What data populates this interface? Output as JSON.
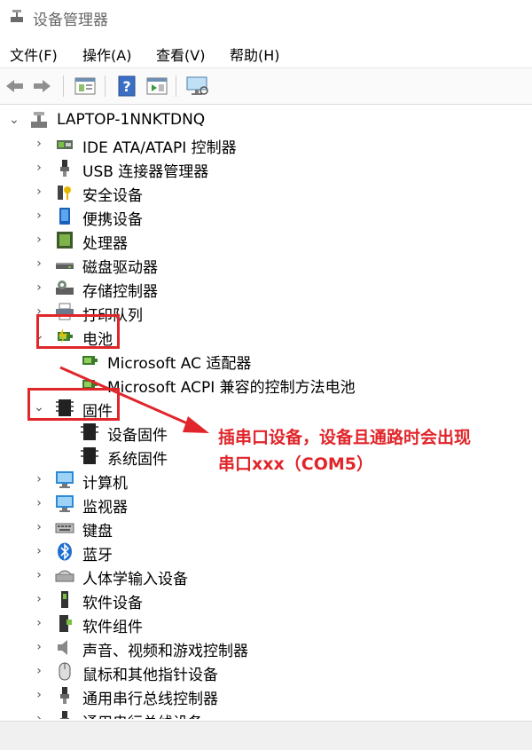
{
  "window": {
    "title": "设备管理器"
  },
  "menu": [
    "文件(F)",
    "操作(A)",
    "查看(V)",
    "帮助(H)"
  ],
  "toolbar": [
    "back-icon",
    "forward-icon",
    "properties-icon",
    "help-icon",
    "view-icon",
    "monitor-icon"
  ],
  "tree": {
    "root": "LAPTOP-1NNKTDNQ",
    "items": [
      {
        "label": "IDE ATA/ATAPI 控制器",
        "icon": "ide-controller-icon"
      },
      {
        "label": "USB 连接器管理器",
        "icon": "usb-icon"
      },
      {
        "label": "安全设备",
        "icon": "security-key-icon"
      },
      {
        "label": "便携设备",
        "icon": "portable-device-icon"
      },
      {
        "label": "处理器",
        "icon": "processor-icon"
      },
      {
        "label": "磁盘驱动器",
        "icon": "disk-drive-icon"
      },
      {
        "label": "存储控制器",
        "icon": "storage-controller-icon"
      },
      {
        "label": "打印队列",
        "icon": "printer-icon"
      },
      {
        "label": "电池",
        "icon": "battery-icon"
      },
      {
        "label": "Microsoft AC 适配器",
        "icon": "battery-icon"
      },
      {
        "label": "Microsoft ACPI 兼容的控制方法电池",
        "icon": "battery-icon"
      },
      {
        "label": "固件",
        "icon": "firmware-chip-icon"
      },
      {
        "label": "设备固件",
        "icon": "firmware-chip-icon"
      },
      {
        "label": "系统固件",
        "icon": "firmware-chip-icon"
      },
      {
        "label": "计算机",
        "icon": "computer-icon"
      },
      {
        "label": "监视器",
        "icon": "monitor-icon"
      },
      {
        "label": "键盘",
        "icon": "keyboard-icon"
      },
      {
        "label": "蓝牙",
        "icon": "bluetooth-icon"
      },
      {
        "label": "人体学输入设备",
        "icon": "hid-icon"
      },
      {
        "label": "软件设备",
        "icon": "software-device-icon"
      },
      {
        "label": "软件组件",
        "icon": "software-component-icon"
      },
      {
        "label": "声音、视频和游戏控制器",
        "icon": "speaker-icon"
      },
      {
        "label": "鼠标和其他指针设备",
        "icon": "mouse-icon"
      },
      {
        "label": "通用串行总线控制器",
        "icon": "usb-icon"
      },
      {
        "label": "通用串行总线设备",
        "icon": "usb-icon"
      }
    ]
  },
  "annotation": {
    "line1": "插串口设备，设备且通路时会出现",
    "line2": "串口xxx（COM5）"
  },
  "colors": {
    "highlight": "#e0262b",
    "text": "#000000"
  }
}
